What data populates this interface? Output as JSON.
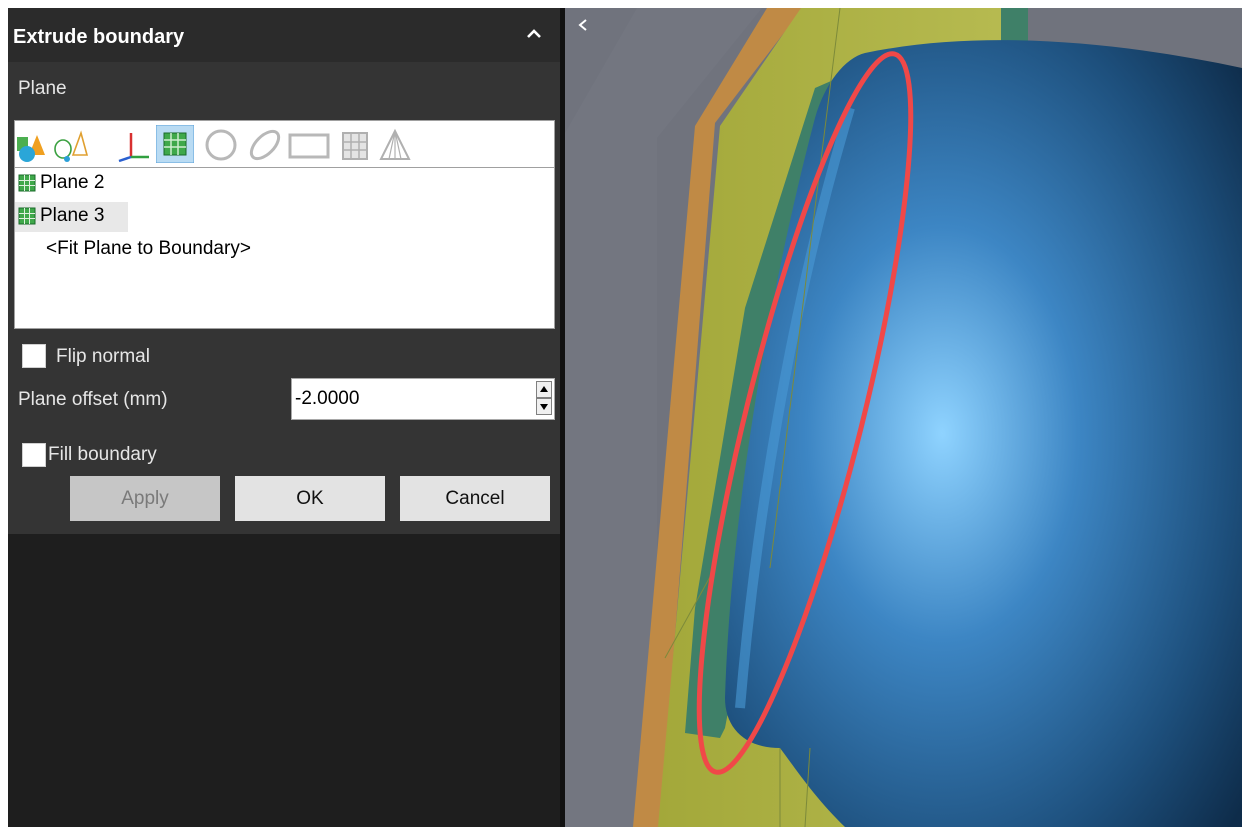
{
  "panel": {
    "title": "Extrude boundary",
    "collapse_icon": "chevron-up-icon",
    "plane_section_label": "Plane",
    "toolbar_icons": [
      "primitives-icon",
      "construction-objects-icon",
      "coordinate-system-icon",
      "plane-icon",
      "circle-icon",
      "ellipse-icon",
      "rectangle-icon",
      "cylinder-grid-icon",
      "cone-icon"
    ],
    "plane_list": [
      {
        "label": "Plane 2",
        "icon": "plane-icon"
      },
      {
        "label": "Plane 3",
        "icon": "plane-icon",
        "highlighted": true
      },
      {
        "label": "<Fit Plane to Boundary>",
        "icon": ""
      }
    ],
    "flip_normal": {
      "label": "Flip normal",
      "checked": false
    },
    "plane_offset": {
      "label": "Plane offset (mm)",
      "value": "-2.0000"
    },
    "fill_boundary": {
      "label": "Fill boundary",
      "checked": false
    },
    "buttons": {
      "apply": "Apply",
      "ok": "OK",
      "cancel": "Cancel"
    }
  },
  "viewport": {
    "expand_icon": "chevron-left-icon",
    "colors": {
      "background": "#70737d",
      "plate_yellow": "#a7ab3e",
      "plate_edge_orange": "#c08a45",
      "rim_green": "#3f8068",
      "tube_blue": "#2a6aa0",
      "highlight_ellipse": "#f04848"
    }
  }
}
